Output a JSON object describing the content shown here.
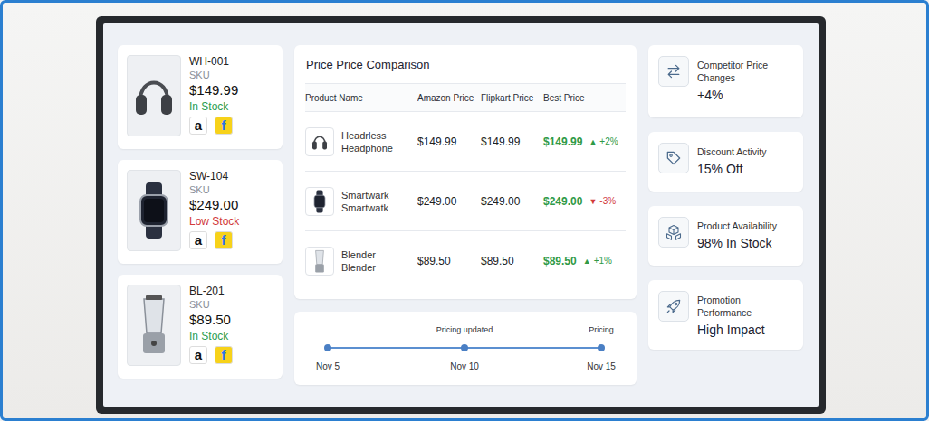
{
  "products": [
    {
      "kind": "headphones",
      "sku": "WH-001",
      "sku_label": "SKU",
      "price": "$149.99",
      "stock": "In Stock",
      "low_stock": false,
      "marketplaces": [
        {
          "label": "a",
          "color": "#ffffff",
          "ink": "#111111"
        },
        {
          "label": "f",
          "color": "#f7d21a",
          "ink": "#2874f0"
        }
      ]
    },
    {
      "kind": "watch",
      "sku": "SW-104",
      "sku_label": "SKU",
      "price": "$249.00",
      "stock": "Low Stock",
      "low_stock": true,
      "marketplaces": [
        {
          "label": "a",
          "color": "#ffffff",
          "ink": "#111111"
        },
        {
          "label": "f",
          "color": "#f7d21a",
          "ink": "#2874f0"
        }
      ]
    },
    {
      "kind": "blender",
      "sku": "BL-201",
      "sku_label": "SKU",
      "price": "$89.50",
      "stock": "In Stock",
      "low_stock": false,
      "marketplaces": [
        {
          "label": "a",
          "color": "#ffffff",
          "ink": "#111111"
        },
        {
          "label": "f",
          "color": "#f7d21a",
          "ink": "#2874f0"
        }
      ]
    }
  ],
  "comparison": {
    "title": "Price Price Comparison",
    "columns": [
      "Product Name",
      "Amazon Price",
      "Flipkart Price",
      "Best Price"
    ],
    "rows": [
      {
        "kind": "headphones",
        "name_lines": [
          "Headrless",
          "Headphone"
        ],
        "amazon": "$149.99",
        "flipkart": "$149.99",
        "best": "$149.99",
        "trend_icon": "▲",
        "change": "+2%",
        "trend": "up"
      },
      {
        "kind": "watch",
        "name_lines": [
          "Smartwark",
          "Smartwatk"
        ],
        "amazon": "$249.00",
        "flipkart": "$249.00",
        "best": "$249.00",
        "trend_icon": "▼",
        "change": "-3%",
        "trend": "down"
      },
      {
        "kind": "blender",
        "name_lines": [
          "Blender",
          "Blender"
        ],
        "amazon": "$89.50",
        "flipkart": "$89.50",
        "best": "$89.50",
        "trend_icon": "▲",
        "change": "+1%",
        "trend": "up"
      }
    ]
  },
  "timeline": {
    "points": [
      {
        "label": "",
        "date": "Nov 5"
      },
      {
        "label": "Pricing updated",
        "date": "Nov 10"
      },
      {
        "label": "Pricing",
        "date": "Nov 15"
      }
    ]
  },
  "metrics": [
    {
      "kind": "swap",
      "label_lines": [
        "Competitor Price",
        "Changes"
      ],
      "value": "+4%"
    },
    {
      "kind": "tag",
      "label_lines": [
        "Discount Activity"
      ],
      "value": "15% Off"
    },
    {
      "kind": "boxes",
      "label_lines": [
        "Product Availability"
      ],
      "value": "98% In Stock"
    },
    {
      "kind": "rocket",
      "label_lines": [
        "Promotion Performance"
      ],
      "value": "High Impact"
    }
  ]
}
